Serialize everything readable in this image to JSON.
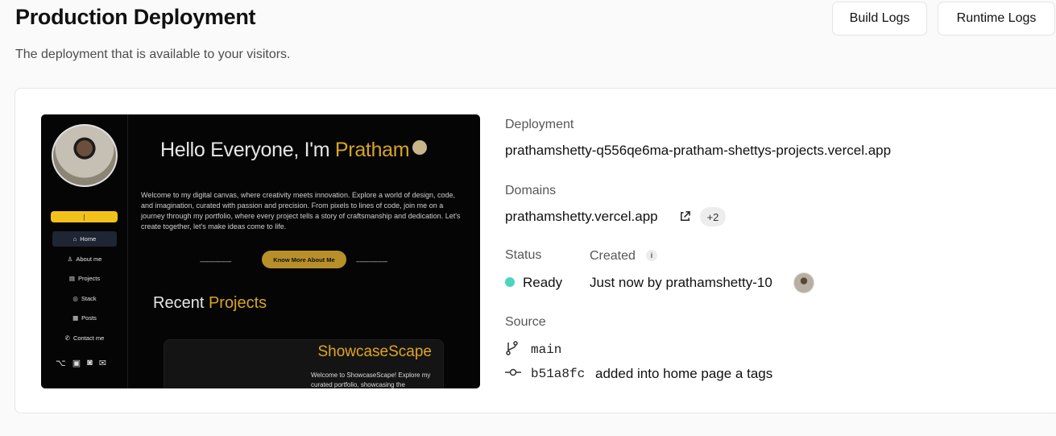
{
  "header": {
    "title": "Production Deployment",
    "subtitle": "The deployment that is available to your visitors.",
    "build_logs_label": "Build Logs",
    "runtime_logs_label": "Runtime Logs"
  },
  "preview": {
    "yellow_bar_text": "|",
    "nav": [
      {
        "label": "Home",
        "icon": "home-icon"
      },
      {
        "label": "About me",
        "icon": "user-icon"
      },
      {
        "label": "Projects",
        "icon": "projects-icon"
      },
      {
        "label": "Stack",
        "icon": "stack-icon"
      },
      {
        "label": "Posts",
        "icon": "posts-icon"
      },
      {
        "label": "Contact me",
        "icon": "phone-icon"
      }
    ],
    "hello_prefix": "Hello Everyone, I'm ",
    "hello_name": "Pratham",
    "intro": "Welcome to my digital canvas, where creativity meets innovation. Explore a world of design, code, and imagination, curated with passion and precision. From pixels to lines of code, join me on a journey through my portfolio, where every project tells a story of craftsmanship and dedication. Let's create together, let's make ideas come to life.",
    "dashes": "------------------",
    "cta_label": "Know More About Me",
    "recent_prefix": "Recent ",
    "recent_highlight": "Projects",
    "project_title": "ShowcaseScape",
    "project_desc": "Welcome to ShowcaseScape! Explore my curated portfolio, showcasing the"
  },
  "info": {
    "deployment_label": "Deployment",
    "deployment_url": "prathamshetty-q556qe6ma-pratham-shettys-projects.vercel.app",
    "domains_label": "Domains",
    "domain": "prathamshetty.vercel.app",
    "domains_extra": "+2",
    "status_label": "Status",
    "status_value": "Ready",
    "status_color": "#4ad5c0",
    "created_label": "Created",
    "created_value": "Just now by prathamshetty-10",
    "source_label": "Source",
    "branch": "main",
    "commit_hash": "b51a8fc",
    "commit_message": "added into home page a tags"
  }
}
